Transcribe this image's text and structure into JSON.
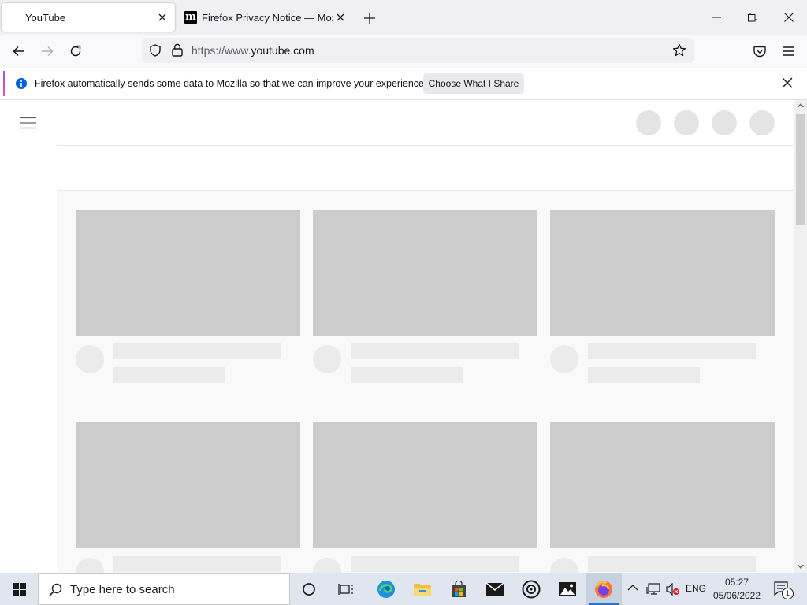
{
  "tabs": [
    {
      "title": "YouTube",
      "active": true
    },
    {
      "title": "Firefox Privacy Notice — Mozilla",
      "active": false
    }
  ],
  "address": {
    "prefix": "https://www.",
    "host": "youtube.com"
  },
  "notification": {
    "message": "Firefox automatically sends some data to Mozilla so that we can improve your experience.",
    "button_label": "Choose What I Share"
  },
  "taskbar": {
    "search_placeholder": "Type here to search",
    "language": "ENG",
    "time": "05:27",
    "date": "05/06/2022",
    "notification_count": "1"
  },
  "colors": {
    "skeleton_thumb": "#cccccc",
    "skeleton_line": "#ebebeb",
    "taskbar": "#dfe6ef",
    "accent": "#0060df"
  }
}
